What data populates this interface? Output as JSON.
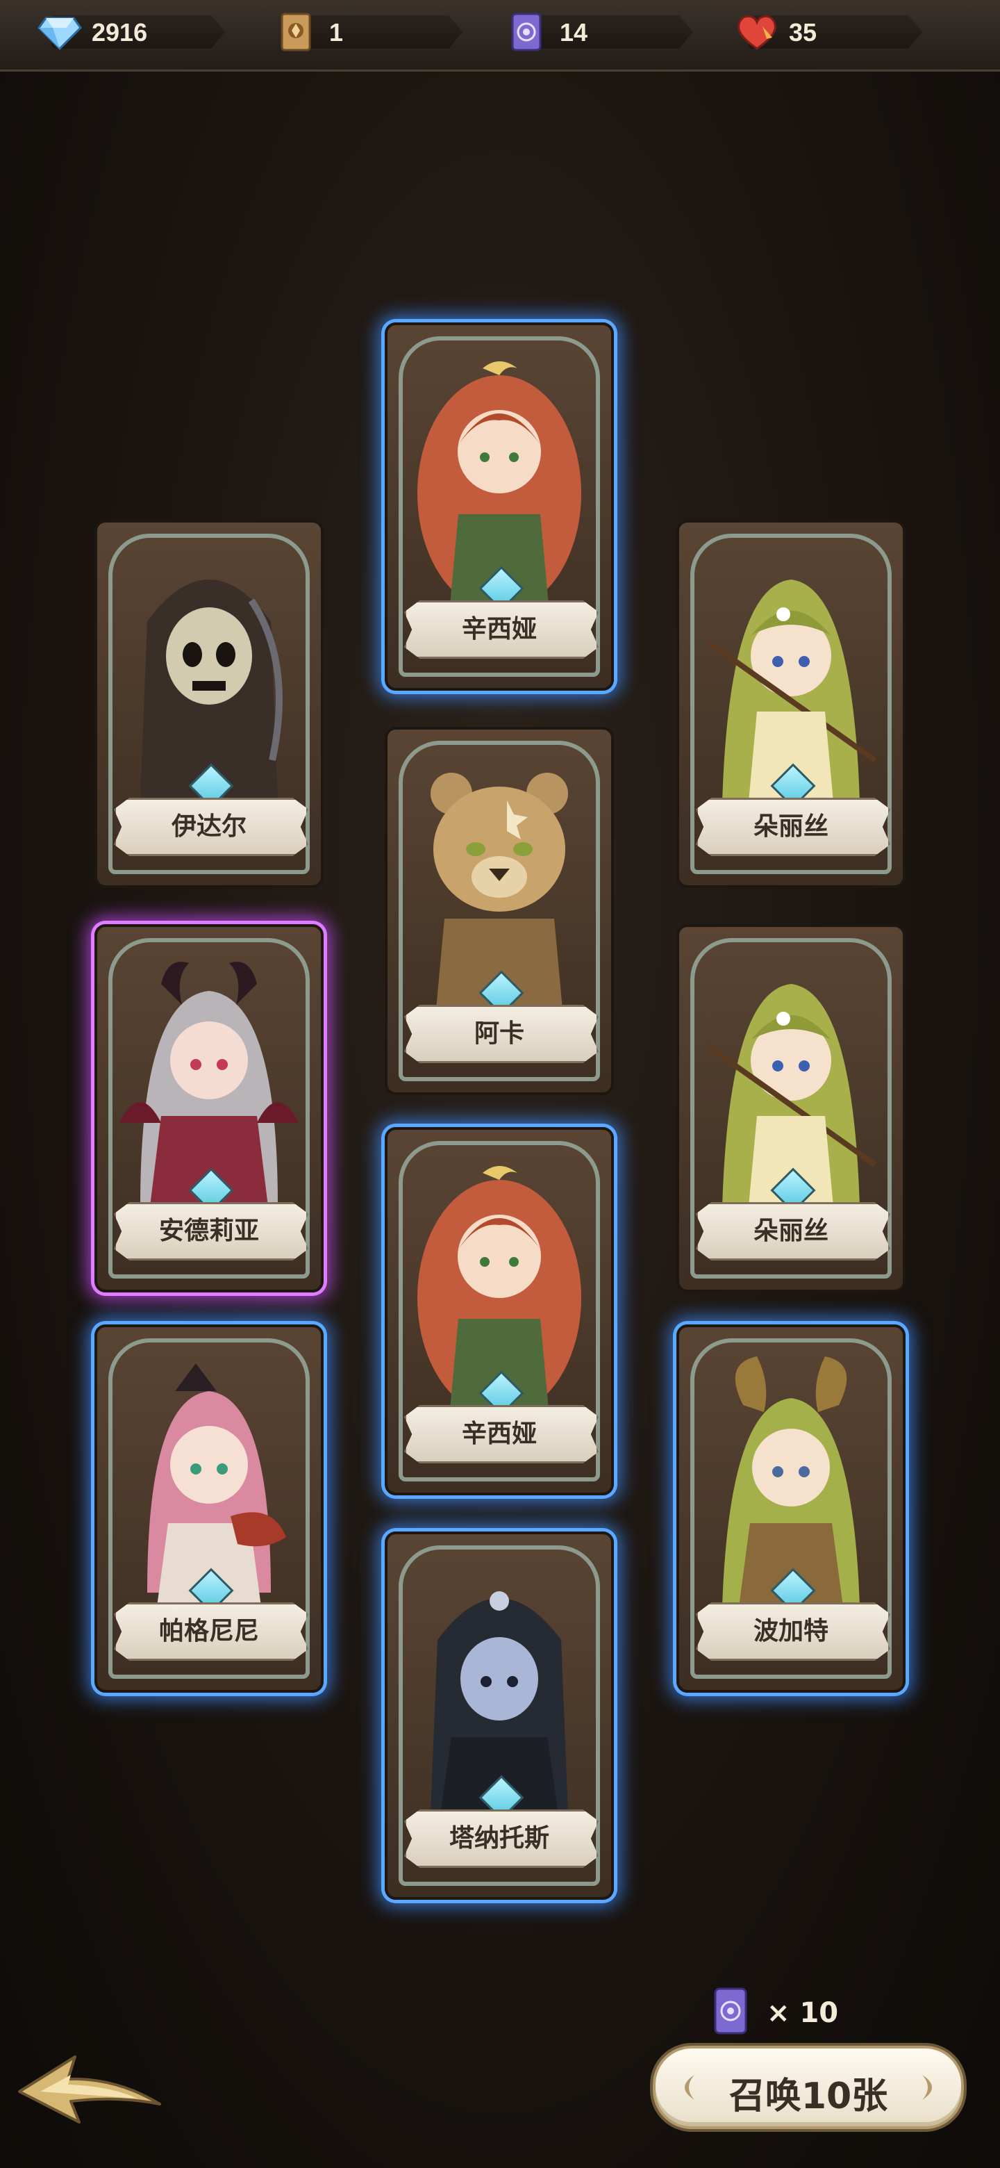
{
  "resources": [
    {
      "icon": "diamond-icon",
      "value": "2916"
    },
    {
      "icon": "scroll-icon",
      "value": "1"
    },
    {
      "icon": "summon-ticket-icon",
      "value": "14"
    },
    {
      "icon": "heart-icon",
      "value": "35"
    }
  ],
  "cards": [
    {
      "name": "辛西娅",
      "rarity_glow": "blue"
    },
    {
      "name": "伊达尔",
      "rarity_glow": "none"
    },
    {
      "name": "朵丽丝",
      "rarity_glow": "none"
    },
    {
      "name": "阿卡",
      "rarity_glow": "none"
    },
    {
      "name": "安德莉亚",
      "rarity_glow": "purple"
    },
    {
      "name": "朵丽丝",
      "rarity_glow": "none"
    },
    {
      "name": "辛西娅",
      "rarity_glow": "blue"
    },
    {
      "name": "帕格尼尼",
      "rarity_glow": "blue"
    },
    {
      "name": "波加特",
      "rarity_glow": "blue"
    },
    {
      "name": "塔纳托斯",
      "rarity_glow": "blue"
    }
  ],
  "summon": {
    "cost_icon": "summon-ticket-icon",
    "cost_quantity": "× 10",
    "button_label": "召唤10张"
  },
  "colors": {
    "glow_blue": "#5aa8ff",
    "glow_purple": "#e07cff",
    "card_brown": "#5a4534",
    "button_cream": "#fffaf0"
  }
}
